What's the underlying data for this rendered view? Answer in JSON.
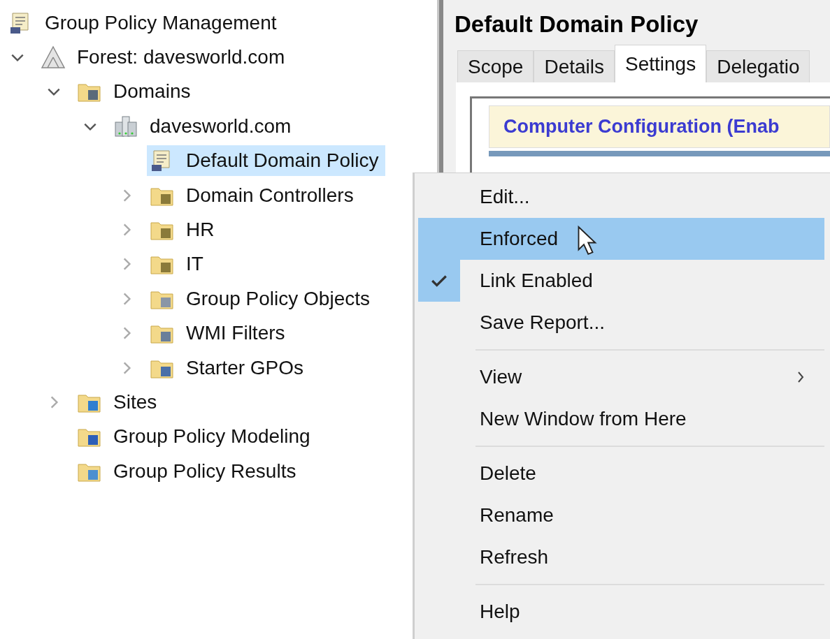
{
  "tree": {
    "label": "Group Policy Management",
    "kind": "root",
    "selected": false,
    "children": [
      {
        "label": "Forest: davesworld.com",
        "kind": "forest",
        "selected": false,
        "expanded": true,
        "children": [
          {
            "label": "Domains",
            "kind": "domains",
            "selected": false,
            "expanded": true,
            "children": [
              {
                "label": "davesworld.com",
                "kind": "domain",
                "selected": false,
                "expanded": true,
                "children": [
                  {
                    "label": "Default Domain Policy",
                    "kind": "gpo-link",
                    "selected": true
                  },
                  {
                    "label": "Domain Controllers",
                    "kind": "ou",
                    "selected": false,
                    "expanded": false
                  },
                  {
                    "label": "HR",
                    "kind": "ou",
                    "selected": false,
                    "expanded": false
                  },
                  {
                    "label": "IT",
                    "kind": "ou",
                    "selected": false,
                    "expanded": false
                  },
                  {
                    "label": "Group Policy Objects",
                    "kind": "gpo-folder",
                    "selected": false,
                    "expanded": false
                  },
                  {
                    "label": "WMI Filters",
                    "kind": "wmi-folder",
                    "selected": false,
                    "expanded": false
                  },
                  {
                    "label": "Starter GPOs",
                    "kind": "starter-folder",
                    "selected": false,
                    "expanded": false
                  }
                ]
              }
            ]
          },
          {
            "label": "Sites",
            "kind": "sites",
            "selected": false,
            "expanded": false
          },
          {
            "label": "Group Policy Modeling",
            "kind": "modeling",
            "selected": false
          },
          {
            "label": "Group Policy Results",
            "kind": "results",
            "selected": false
          }
        ]
      }
    ]
  },
  "details": {
    "title": "Default Domain Policy",
    "tabs": [
      {
        "label": "Scope",
        "selected": false
      },
      {
        "label": "Details",
        "selected": false
      },
      {
        "label": "Settings",
        "selected": true
      },
      {
        "label": "Delegatio",
        "selected": false
      }
    ],
    "report_heading": "Computer Configuration (Enab"
  },
  "context_menu": {
    "groups": [
      [
        {
          "label": "Edit...",
          "checked": false,
          "selected": false,
          "submenu": false
        },
        {
          "label": "Enforced",
          "checked": false,
          "selected": true,
          "submenu": false
        },
        {
          "label": "Link Enabled",
          "checked": true,
          "selected": false,
          "submenu": false
        },
        {
          "label": "Save Report...",
          "checked": false,
          "selected": false,
          "submenu": false
        }
      ],
      [
        {
          "label": "View",
          "checked": false,
          "selected": false,
          "submenu": true
        },
        {
          "label": "New Window from Here",
          "checked": false,
          "selected": false,
          "submenu": false
        }
      ],
      [
        {
          "label": "Delete",
          "checked": false,
          "selected": false,
          "submenu": false
        },
        {
          "label": "Rename",
          "checked": false,
          "selected": false,
          "submenu": false
        },
        {
          "label": "Refresh",
          "checked": false,
          "selected": false,
          "submenu": false
        }
      ],
      [
        {
          "label": "Help",
          "checked": false,
          "selected": false,
          "submenu": false
        }
      ]
    ]
  }
}
